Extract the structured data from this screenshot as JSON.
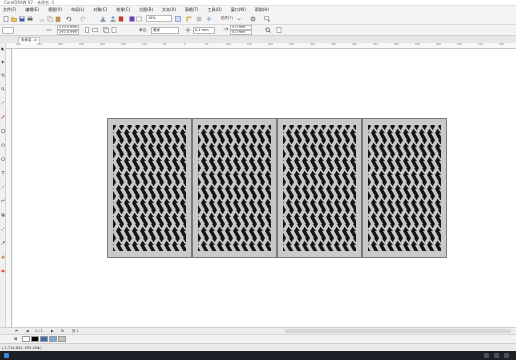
{
  "window": {
    "title": "CorelDRAW X7 - 未命名 -1"
  },
  "menu": [
    "文件(F)",
    "编辑(E)",
    "视图(V)",
    "布局(L)",
    "对象(C)",
    "效果(C)",
    "位图(B)",
    "文本(X)",
    "表格(T)",
    "工具(O)",
    "窗口(W)",
    "帮助(H)"
  ],
  "toolbar": {
    "zoom_value": "16%",
    "snap_label": "贴齐(T)",
    "snap_icon": "snap-chevron-icon"
  },
  "propertybar": {
    "width_value": "270.0 mm",
    "height_value": "297.0 mm",
    "units_label": "单位:",
    "units_value": "毫米",
    "nudge_value": "0.1 mm",
    "dup_x_value": "5.0 mm",
    "dup_y_value": "5.0 mm"
  },
  "document_tab": {
    "label": "未命名 -1"
  },
  "ruler": {
    "h_ticks": [
      "400",
      "350",
      "300",
      "250",
      "200",
      "150",
      "100",
      "50",
      "0",
      "50",
      "100",
      "150",
      "200",
      "250",
      "300",
      "350",
      "400",
      "450",
      "500",
      "550",
      "600",
      "650",
      "700",
      "750"
    ]
  },
  "pagenav": {
    "pages": "1 / 1",
    "page_label": "页 1"
  },
  "palette": {
    "colors": [
      "#ffffff",
      "#000000",
      "#3a6fb0",
      "#7fa7d6",
      "#c0c0c0"
    ]
  },
  "status": {
    "coords": "(-1,714.842, 555.403 )"
  },
  "artwork": {
    "panel_count": 4,
    "panel_fill": "#c9c9c9",
    "pattern_color": "#151515"
  }
}
